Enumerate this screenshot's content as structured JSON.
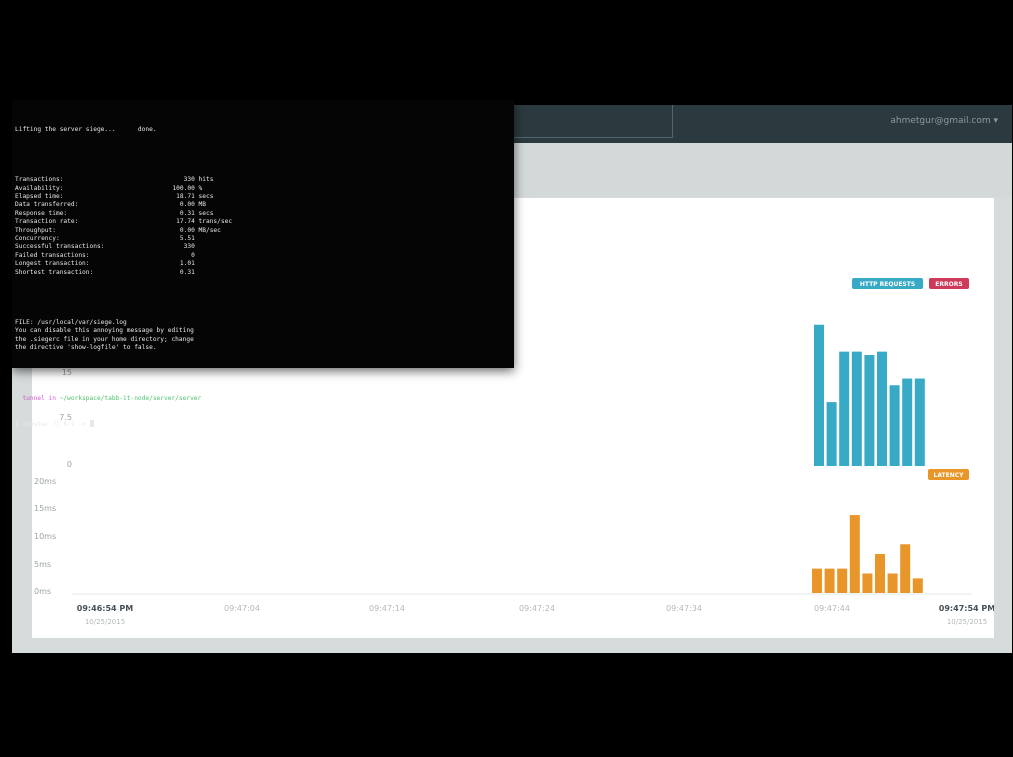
{
  "app": {
    "user_menu": "ahmetgur@gmail.com ▾"
  },
  "chart_data": [
    {
      "type": "bar",
      "legend": [
        "HTTP REQUESTS",
        "ERRORS"
      ],
      "legend_colors": [
        "#38aac5",
        "#d03a5a"
      ],
      "legend_position": "top-right",
      "y_ticks": [
        "15",
        "7.5",
        "0"
      ],
      "ylim": [
        0,
        22
      ],
      "series": [
        {
          "name": "HTTP REQUESTS",
          "color": "#38aac5",
          "values": [
            21,
            9.5,
            17,
            17,
            16.5,
            17,
            12,
            13,
            13
          ]
        },
        {
          "name": "ERRORS",
          "color": "#d03a5a",
          "values": [
            0,
            0,
            0,
            0,
            0,
            0,
            0,
            0,
            0
          ]
        }
      ]
    },
    {
      "type": "bar",
      "legend": [
        "LATENCY"
      ],
      "legend_colors": [
        "#e8952a"
      ],
      "legend_position": "top-right",
      "y_ticks": [
        "20ms",
        "15ms",
        "10ms",
        "5ms",
        "0ms"
      ],
      "ylim": [
        0,
        20
      ],
      "series": [
        {
          "name": "LATENCY",
          "color": "#e8952a",
          "values": [
            5,
            5,
            5,
            16,
            4,
            8,
            4,
            10,
            3
          ]
        }
      ]
    }
  ],
  "x_axis": {
    "ticks": [
      {
        "time": "09:46:54 PM",
        "date": "10/25/2015",
        "bold": true
      },
      {
        "time": "09:47:04",
        "date": "",
        "bold": false
      },
      {
        "time": "09:47:14",
        "date": "",
        "bold": false
      },
      {
        "time": "09:47:24",
        "date": "",
        "bold": false
      },
      {
        "time": "09:47:34",
        "date": "",
        "bold": false
      },
      {
        "time": "09:47:44",
        "date": "",
        "bold": false
      },
      {
        "time": "09:47:54 PM",
        "date": "10/25/2015",
        "bold": true
      }
    ]
  },
  "terminal": {
    "top_line": "Lifting the server siege...      done.",
    "stats": [
      {
        "label": "Transactions:",
        "value": "     330 hits"
      },
      {
        "label": "Availability:",
        "value": "  100.00 %"
      },
      {
        "label": "Elapsed time:",
        "value": "   18.71 secs"
      },
      {
        "label": "Data transferred:",
        "value": "    0.00 MB"
      },
      {
        "label": "Response time:",
        "value": "    0.31 secs"
      },
      {
        "label": "Transaction rate:",
        "value": "   17.74 trans/sec"
      },
      {
        "label": "Throughput:",
        "value": "    0.00 MB/sec"
      },
      {
        "label": "Concurrency:",
        "value": "    5.51"
      },
      {
        "label": "Successful transactions:",
        "value": "     330"
      },
      {
        "label": "Failed transactions:",
        "value": "       0"
      },
      {
        "label": "Longest transaction:",
        "value": "    1.01"
      },
      {
        "label": "Shortest transaction:",
        "value": "    0.31"
      }
    ],
    "notes": [
      "FILE: /usr/local/var/siege.log",
      "You can disable this annoying message by editing",
      "the .siegerc file in your home directory; change",
      "the directive 'show-logfile' to false."
    ],
    "prompt_user": "  tunnel in ",
    "prompt_path": "~/workspace/tabb-it-node/server/server",
    "prompt_line2": "$ (master ?) $-1 -> "
  }
}
